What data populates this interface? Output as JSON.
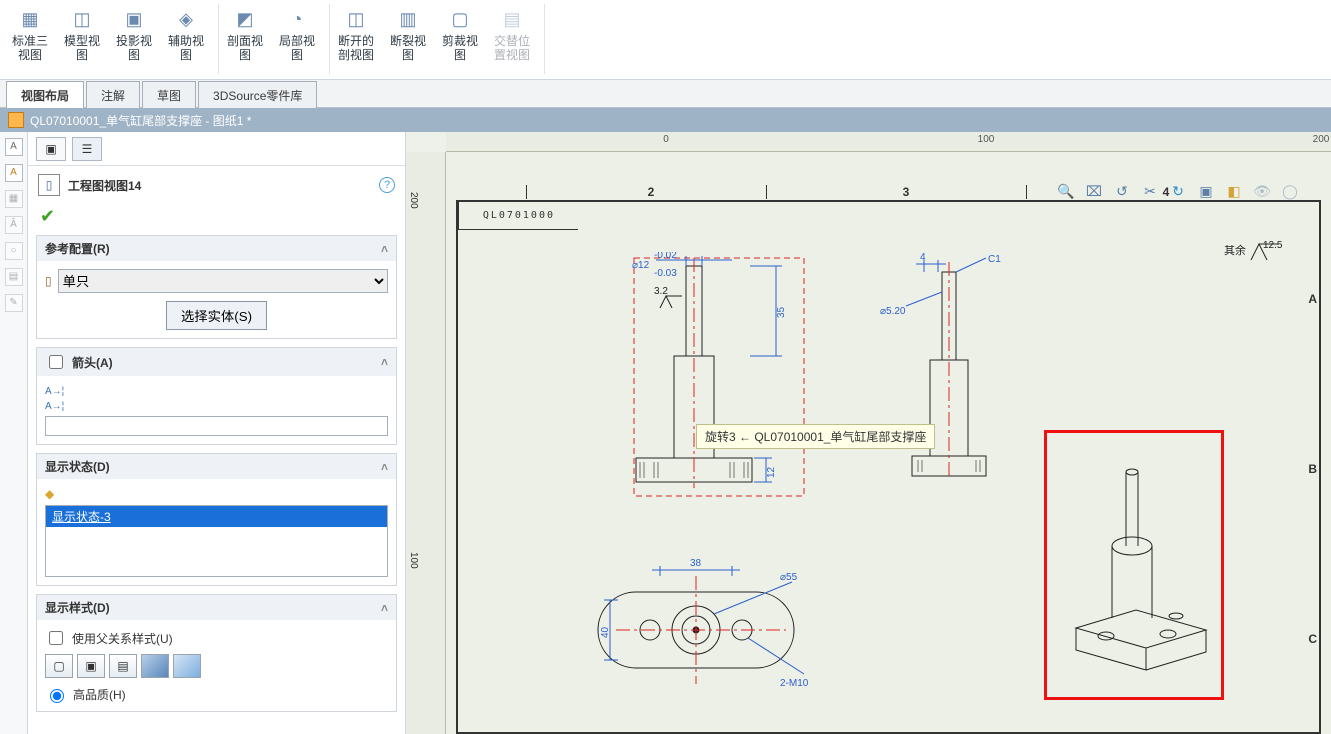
{
  "ribbon": {
    "buttons": [
      {
        "l1": "标准三",
        "l2": "视图"
      },
      {
        "l1": "模型视",
        "l2": "图"
      },
      {
        "l1": "投影视",
        "l2": "图"
      },
      {
        "l1": "辅助视",
        "l2": "图"
      },
      {
        "l1": "剖面视",
        "l2": "图"
      },
      {
        "l1": "局部视",
        "l2": "图"
      },
      {
        "l1": "断开的",
        "l2": "剖视图"
      },
      {
        "l1": "断裂视",
        "l2": "图"
      },
      {
        "l1": "剪裁视",
        "l2": "图"
      },
      {
        "l1": "交替位",
        "l2": "置视图"
      }
    ]
  },
  "tabs": {
    "t1": "视图布局",
    "t2": "注解",
    "t3": "草图",
    "t4": "3DSource零件库"
  },
  "doc": {
    "title": "QL07010001_单气缸尾部支撑座 - 图纸1 *"
  },
  "panel": {
    "title": "工程图视图14",
    "sec_config": "参考配置(R)",
    "combo_value": "单只",
    "select_entity": "选择实体(S)",
    "sec_arrow": "箭头(A)",
    "sec_dispstate": "显示状态(D)",
    "dispstate_item": "显示状态-3",
    "sec_dispstyle": "显示样式(D)",
    "parent_style": "使用父关系样式(U)",
    "hq": "高品质(H)"
  },
  "canvas": {
    "ruler": {
      "r0": "0",
      "r100": "100",
      "r200": "200",
      "r200b": "200",
      "v200": "200",
      "v100": "100"
    },
    "zones": {
      "z2": "2",
      "z3": "3",
      "z4": "4",
      "A": "A",
      "B": "B",
      "C": "C"
    },
    "title_block": "QL0701000",
    "surf_note": "其余",
    "surf_val": "12.5",
    "tooltip": "旋转3 ← QL07010001_单气缸尾部支撑座",
    "dims": {
      "d12_up": "-0.02",
      "d12": "⌀12",
      "d12_lo": "-0.03",
      "h35": "35",
      "h12": "12",
      "sv": "3.2",
      "c1": "C1",
      "d520": "⌀5.20",
      "sp4": "4",
      "w38": "38",
      "h40": "40",
      "d55": "⌀55",
      "m10": "2-M10"
    }
  }
}
